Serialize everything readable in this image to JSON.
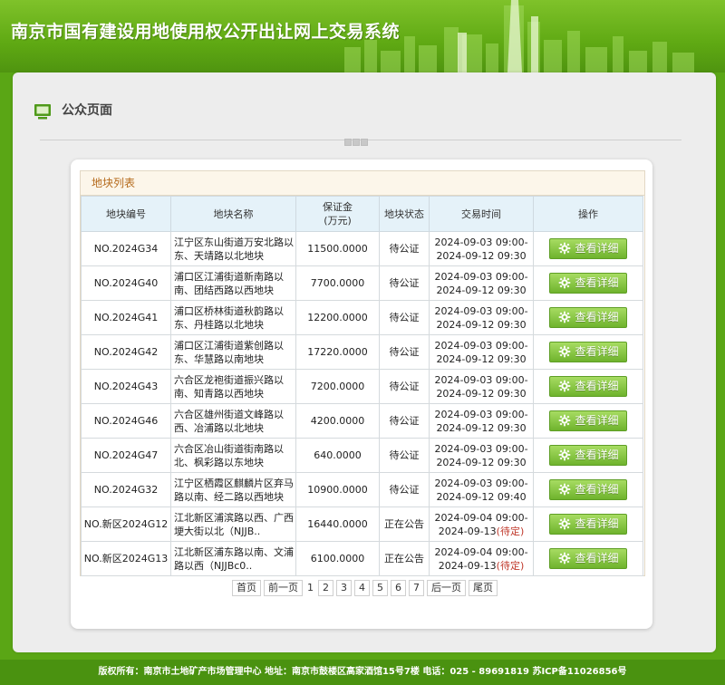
{
  "header": {
    "title": "南京市国有建设用地使用权公开出让网上交易系统"
  },
  "page": {
    "title": "公众页面"
  },
  "list": {
    "title": "地块列表",
    "columns": [
      "地块编号",
      "地块名称",
      "保证金\n(万元)",
      "地块状态",
      "交易时间",
      "操作"
    ],
    "rows": [
      {
        "id": "NO.2024G34",
        "name": "江宁区东山街道万安北路以东、天靖路以北地块",
        "deposit": "11500.0000",
        "status": "待公证",
        "time_start": "2024-09-03 09:00-",
        "time_end": "2024-09-12 09:30",
        "time_note": "",
        "action": "查看详细"
      },
      {
        "id": "NO.2024G40",
        "name": "浦口区江浦街道新南路以南、团结西路以西地块",
        "deposit": "7700.0000",
        "status": "待公证",
        "time_start": "2024-09-03 09:00-",
        "time_end": "2024-09-12 09:30",
        "time_note": "",
        "action": "查看详细"
      },
      {
        "id": "NO.2024G41",
        "name": "浦口区桥林街道秋韵路以东、丹桂路以北地块",
        "deposit": "12200.0000",
        "status": "待公证",
        "time_start": "2024-09-03 09:00-",
        "time_end": "2024-09-12 09:30",
        "time_note": "",
        "action": "查看详细"
      },
      {
        "id": "NO.2024G42",
        "name": "浦口区江浦街道紫创路以东、华慧路以南地块",
        "deposit": "17220.0000",
        "status": "待公证",
        "time_start": "2024-09-03 09:00-",
        "time_end": "2024-09-12 09:30",
        "time_note": "",
        "action": "查看详细"
      },
      {
        "id": "NO.2024G43",
        "name": "六合区龙袍街道振兴路以南、知青路以西地块",
        "deposit": "7200.0000",
        "status": "待公证",
        "time_start": "2024-09-03 09:00-",
        "time_end": "2024-09-12 09:30",
        "time_note": "",
        "action": "查看详细"
      },
      {
        "id": "NO.2024G46",
        "name": "六合区雄州街道文峰路以西、冶浦路以北地块",
        "deposit": "4200.0000",
        "status": "待公证",
        "time_start": "2024-09-03 09:00-",
        "time_end": "2024-09-12 09:30",
        "time_note": "",
        "action": "查看详细"
      },
      {
        "id": "NO.2024G47",
        "name": "六合区冶山街道街南路以北、枫彩路以东地块",
        "deposit": "640.0000",
        "status": "待公证",
        "time_start": "2024-09-03 09:00-",
        "time_end": "2024-09-12 09:30",
        "time_note": "",
        "action": "查看详细"
      },
      {
        "id": "NO.2024G32",
        "name": "江宁区栖霞区麒麟片区弃马路以南、经二路以西地块",
        "deposit": "10900.0000",
        "status": "待公证",
        "time_start": "2024-09-03 09:00-",
        "time_end": "2024-09-12 09:40",
        "time_note": "",
        "action": "查看详细"
      },
      {
        "id": "NO.新区2024G12",
        "name": "江北新区浦滨路以西、广西埂大街以北（NJJB..",
        "deposit": "16440.0000",
        "status": "正在公告",
        "time_start": "2024-09-04 09:00-",
        "time_end": "2024-09-13",
        "time_note": "(待定)",
        "action": "查看详细"
      },
      {
        "id": "NO.新区2024G13",
        "name": "江北新区浦东路以南、文浦路以西（NJJBc0..",
        "deposit": "6100.0000",
        "status": "正在公告",
        "time_start": "2024-09-04 09:00-",
        "time_end": "2024-09-13",
        "time_note": "(待定)",
        "action": "查看详细"
      }
    ]
  },
  "pager": {
    "first": "首页",
    "prev": "前一页",
    "current": "1",
    "pages": [
      "2",
      "3",
      "4",
      "5",
      "6",
      "7"
    ],
    "next": "后一页",
    "last": "尾页"
  },
  "footer": {
    "text": "版权所有：南京市土地矿产市场管理中心    地址：南京市鼓楼区高家酒馆15号7楼    电话：025 - 89691819    苏ICP备11026856号"
  },
  "colors": {
    "brand_green": "#5aa615",
    "button_green": "#7cbf34",
    "pending_red": "#c0392b",
    "list_title": "#b56a1c"
  },
  "icons": {
    "page": "monitor-icon",
    "action": "gear-icon"
  }
}
